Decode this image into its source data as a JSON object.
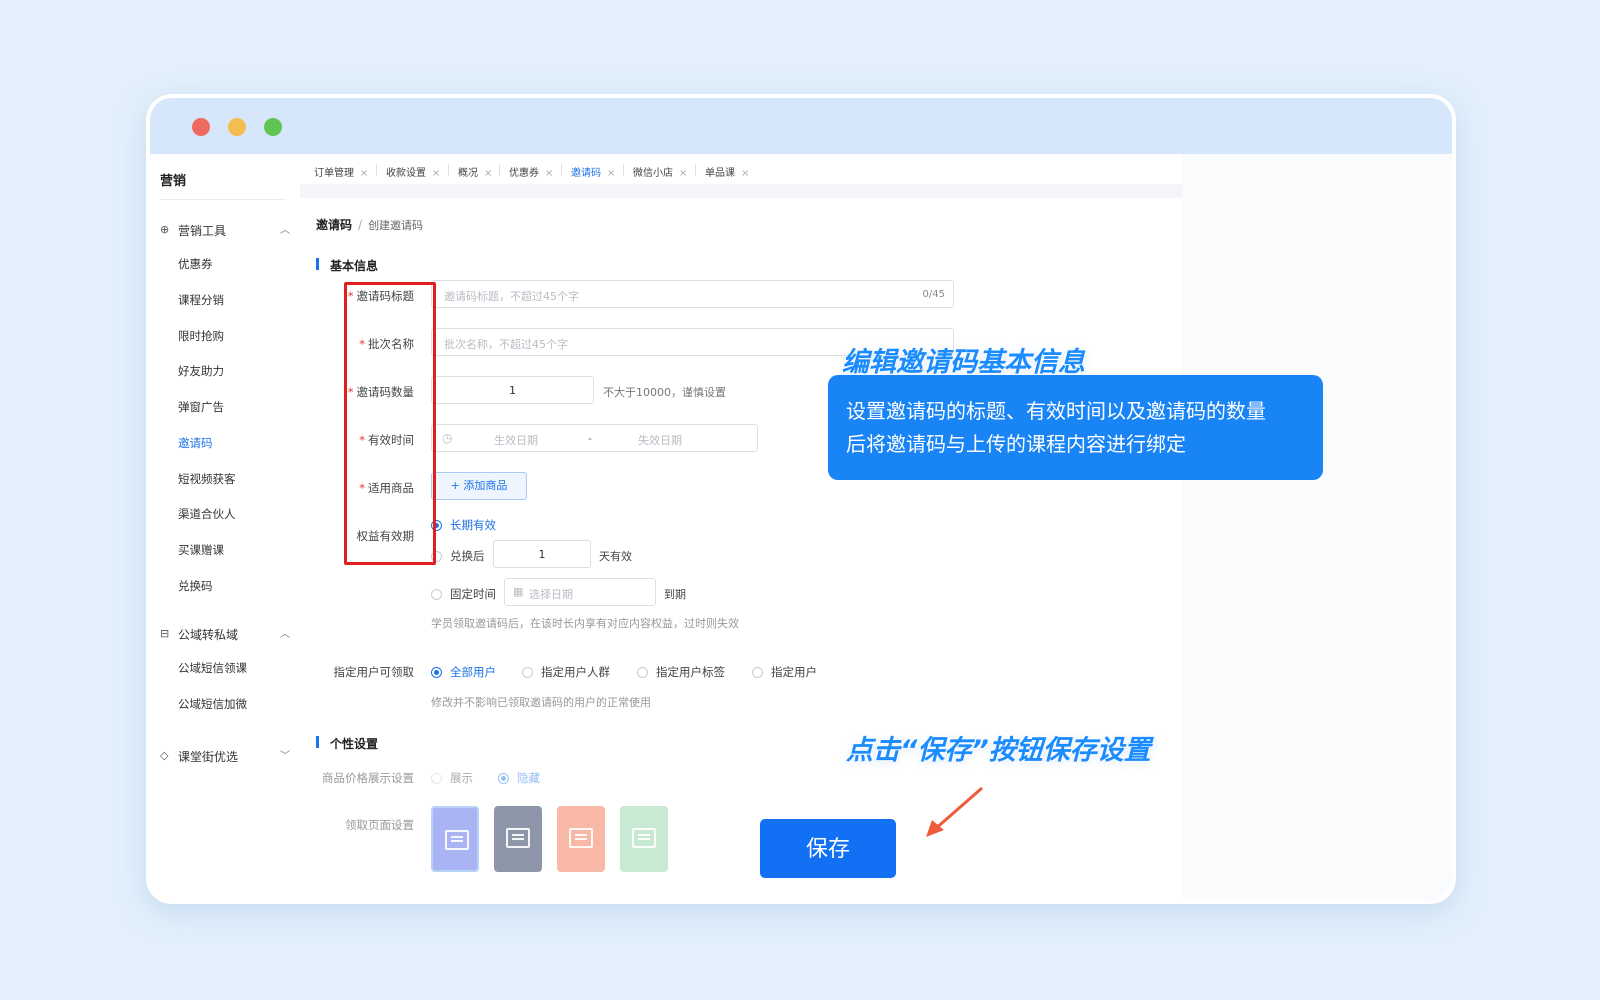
{
  "sidebar": {
    "title": "营销",
    "groups": [
      {
        "label": "营销工具",
        "icon": "gift-icon",
        "chevron": "︿"
      },
      {
        "label": "公域转私域",
        "icon": "transfer-icon",
        "chevron": "︿"
      },
      {
        "label": "课堂街优选",
        "icon": "diamond-icon",
        "chevron": "﹀"
      }
    ],
    "items": [
      "优惠券",
      "课程分销",
      "限时抢购",
      "好友助力",
      "弹窗广告",
      "邀请码",
      "短视频获客",
      "渠道合伙人",
      "买课赠课",
      "兑换码"
    ],
    "items2": [
      "公域短信领课",
      "公域短信加微"
    ],
    "active_item": "邀请码"
  },
  "tabs": [
    {
      "label": "订单管理"
    },
    {
      "label": "收款设置"
    },
    {
      "label": "概况"
    },
    {
      "label": "优惠券"
    },
    {
      "label": "邀请码",
      "active": true
    },
    {
      "label": "微信小店"
    },
    {
      "label": "单品课"
    }
  ],
  "tab_close": "×",
  "breadcrumb": {
    "current": "邀请码",
    "sep": "/",
    "page": "创建邀请码"
  },
  "sections": {
    "basic": "基本信息",
    "custom": "个性设置"
  },
  "form": {
    "required_mark": "*",
    "title_label": "邀请码标题",
    "title_placeholder": "邀请码标题，不超过45个字",
    "title_count": "0/45",
    "batch_label": "批次名称",
    "batch_placeholder": "批次名称，不超过45个字",
    "quantity_label": "邀请码数量",
    "quantity_value": "1",
    "quantity_hint": "不大于10000，谨慎设置",
    "time_label": "有效时间",
    "start_placeholder": "生效日期",
    "date_sep": "-",
    "end_placeholder": "失效日期",
    "goods_label": "适用商品",
    "add_goods": "+ 添加商品",
    "validity_label": "权益有效期",
    "opt_long": "长期有效",
    "opt_after": "兑换后",
    "after_days": "1",
    "days_unit": "天有效",
    "opt_fixed": "固定时间",
    "fixed_placeholder": "选择日期",
    "expire_suffix": "到期",
    "validity_hint": "学员领取邀请码后，在该时长内享有对应内容权益，过时则失效",
    "user_label": "指定用户可领取",
    "user_opts": [
      "全部用户",
      "指定用户人群",
      "指定用户标签",
      "指定用户"
    ],
    "user_hint": "修改并不影响已领取邀请码的用户的正常使用",
    "price_label": "商品价格展示设置",
    "price_opts": [
      "展示",
      "隐藏"
    ],
    "page_label": "领取页面设置"
  },
  "callout": {
    "title": "编辑邀请码基本信息",
    "line1": "设置邀请码的标题、有效时间以及邀请码的数量",
    "line2": "后将邀请码与上传的课程内容进行绑定",
    "save_tip": "点击“保存”按钮保存设置"
  },
  "save_label": "保存",
  "colors": {
    "accent": "#1a73e8",
    "highlight": "#e02020",
    "save": "#1270f5",
    "callout": "#1984f5"
  }
}
